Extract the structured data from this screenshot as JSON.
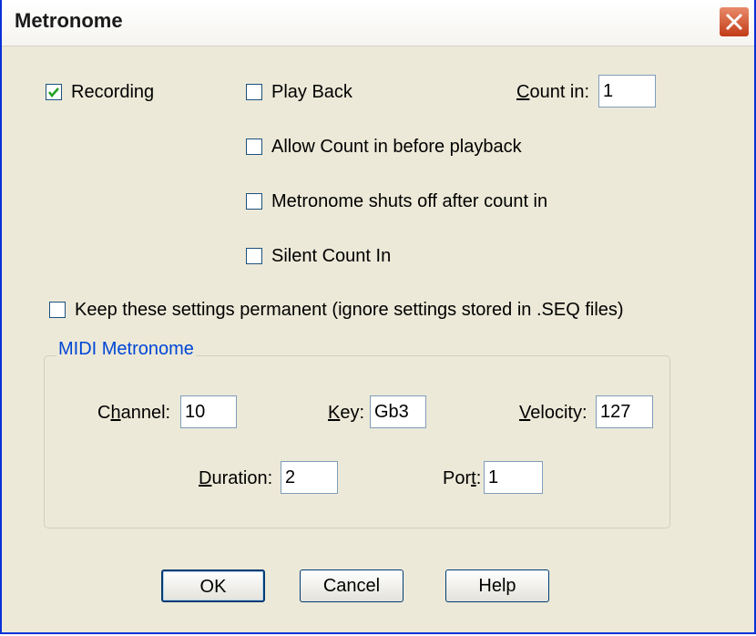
{
  "window": {
    "title": "Metronome"
  },
  "options": {
    "recording": {
      "label": "Recording",
      "checked": true
    },
    "playback": {
      "label": "Play Back",
      "checked": false
    },
    "count_in": {
      "label_prefix": "C",
      "label_rest": "ount in:",
      "value": "1"
    },
    "allow_count_in": {
      "label": "Allow Count in before playback",
      "checked": false
    },
    "shuts_off": {
      "label": "Metronome shuts off after count in",
      "checked": false
    },
    "silent_count_in": {
      "label": "Silent Count In",
      "checked": false
    },
    "keep_settings": {
      "label": "Keep these settings permanent (ignore settings stored in .SEQ files)",
      "checked": false
    }
  },
  "midi_metronome": {
    "title": "MIDI Metronome",
    "channel": {
      "label_a": "C",
      "label_u": "h",
      "label_b": "annel:",
      "value": "10"
    },
    "key": {
      "label_u": "K",
      "label_b": "ey:",
      "value": "Gb3"
    },
    "velocity": {
      "label_u": "V",
      "label_b": "elocity:",
      "value": "127"
    },
    "duration": {
      "label_u": "D",
      "label_b": "uration:",
      "value": "2"
    },
    "port": {
      "label_a": "Por",
      "label_u": "t",
      "label_b": ":",
      "value": "1"
    }
  },
  "buttons": {
    "ok": "OK",
    "cancel": "Cancel",
    "help": "Help"
  }
}
